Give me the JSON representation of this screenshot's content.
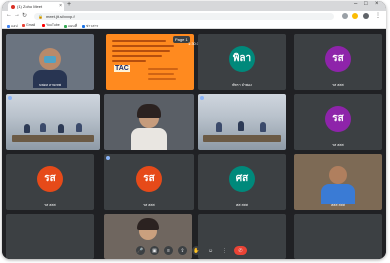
{
  "browser": {
    "tab_title": "(1) Zoho Meet",
    "tab_close": "×",
    "new_tab": "+",
    "url": "meet.jit.si/xxxp-f",
    "window_controls": {
      "minimize": "–",
      "maximize": "□",
      "close": "×"
    },
    "bookmarks": [
      "แอป",
      "Gmail",
      "YouTube",
      "แผนที่",
      "ข่าวสาร"
    ]
  },
  "meeting": {
    "slide": {
      "logo_text": "TAC",
      "page_indicator": "Page 1",
      "timer": "1:30:18",
      "badge": "A"
    },
    "tiles": [
      {
        "name": "นพดล ลายเทพ",
        "kind": "video-face"
      },
      {
        "name": "",
        "kind": "presentation"
      },
      {
        "name": "พัชรา ลำพอง",
        "kind": "avatar",
        "initials": "พิลา",
        "color": "#00897b"
      },
      {
        "name": "รส สสส",
        "kind": "avatar",
        "initials": "รส",
        "color": "#8e24aa"
      },
      {
        "name": "",
        "kind": "video-room"
      },
      {
        "name": "",
        "kind": "video-face-woman"
      },
      {
        "name": "",
        "kind": "video-room"
      },
      {
        "name": "รส สสส",
        "kind": "avatar",
        "initials": "รส",
        "color": "#8e24aa"
      },
      {
        "name": "รส สสส",
        "kind": "avatar",
        "initials": "รส",
        "color": "#e64a19"
      },
      {
        "name": "รส สสส",
        "kind": "avatar",
        "initials": "รส",
        "color": "#e64a19"
      },
      {
        "name": "ศส สสส",
        "kind": "avatar",
        "initials": "ศส",
        "color": "#00897b"
      },
      {
        "name": "สสส สสส",
        "kind": "video-face"
      },
      {
        "name": "",
        "kind": "empty"
      },
      {
        "name": "",
        "kind": "video-face-woman"
      },
      {
        "name": "",
        "kind": "empty"
      },
      {
        "name": "",
        "kind": "empty"
      }
    ],
    "controls": {
      "mic": "mic-icon",
      "camera": "camera-icon",
      "captions": "captions-icon",
      "present": "present-icon",
      "raise_hand": "hand-icon",
      "more": "more-icon",
      "end_call": "end-call-icon"
    }
  }
}
